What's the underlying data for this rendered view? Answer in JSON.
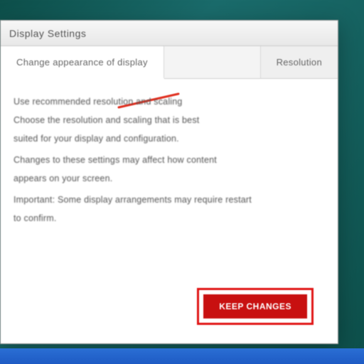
{
  "window": {
    "title": "Display Settings"
  },
  "tabs": {
    "left": "Change appearance of display",
    "right": "Resolution"
  },
  "body": {
    "l1": "Use recommended resolution and scaling",
    "l2": "Choose the resolution and scaling that is best",
    "l3": "suited for your display and configuration.",
    "l4": "Changes to these settings may affect how content",
    "l5": "appears on your screen.",
    "l6": "Important: Some display arrangements may require restart",
    "l7": "to confirm."
  },
  "action": {
    "label": "Keep changes"
  },
  "colors": {
    "danger": "#c81010",
    "danger_border": "#e11515"
  }
}
